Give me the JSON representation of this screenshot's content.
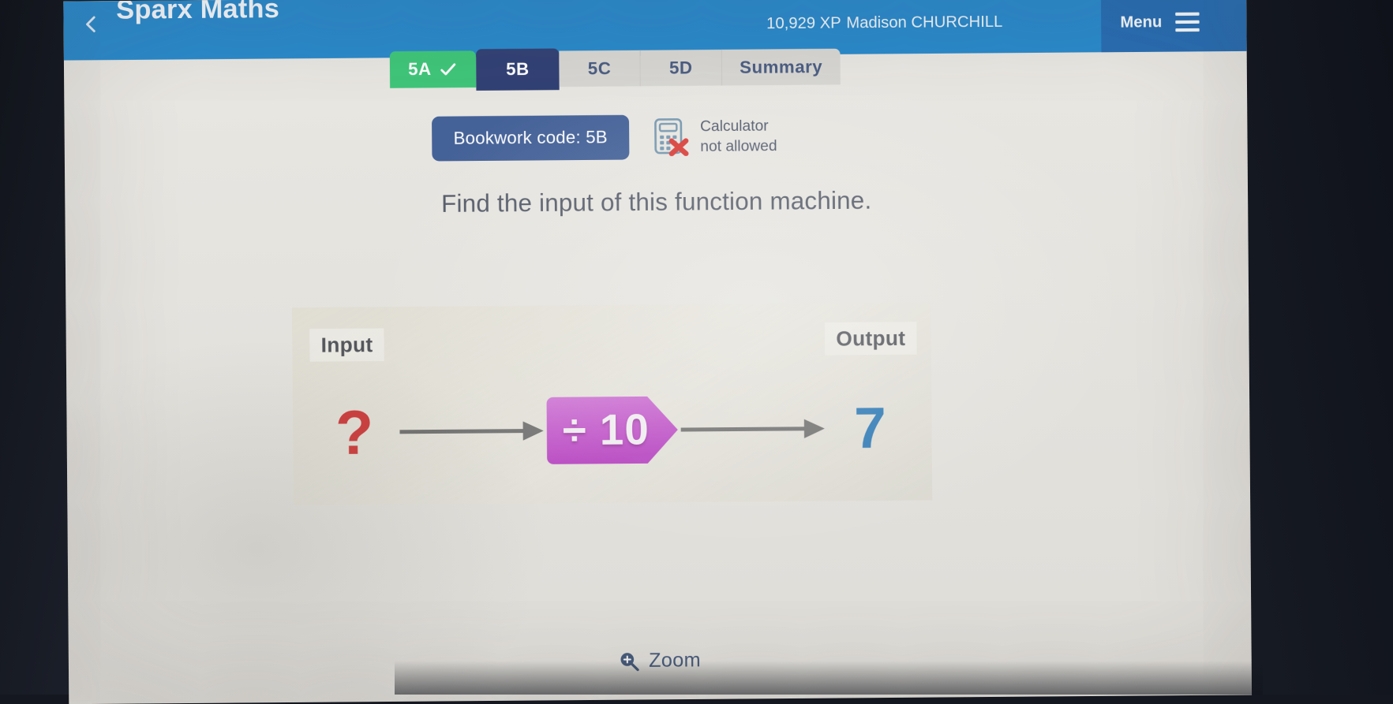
{
  "app": {
    "title": "Sparx Maths",
    "back_icon": "back-chevron-icon",
    "xp": "10,929 XP",
    "user": "Madison CHURCHILL",
    "menu_label": "Menu",
    "menu_icon": "hamburger-icon",
    "accent_blue": "#1f83c8",
    "accent_blue_dark": "#1c65ae"
  },
  "tabs": [
    {
      "label": "5A",
      "state": "completed",
      "icon": "check-icon",
      "color": "#35c473"
    },
    {
      "label": "5B",
      "state": "active",
      "color": "#27376e"
    },
    {
      "label": "5C",
      "state": "idle",
      "color": "#d6d5d1"
    },
    {
      "label": "5D",
      "state": "idle",
      "color": "#d6d5d1"
    },
    {
      "label": "Summary",
      "state": "idle",
      "color": "#d6d5d1"
    }
  ],
  "bookwork": {
    "code_label": "Bookwork code: 5B",
    "badge_color": "#3b5a94"
  },
  "calculator": {
    "icon": "calculator-not-allowed-icon",
    "line1": "Calculator",
    "line2": "not allowed"
  },
  "question": {
    "prompt": "Find the input of this function machine."
  },
  "machine": {
    "input_label": "Input",
    "output_label": "Output",
    "input_value": "?",
    "input_color": "#cf3434",
    "output_value": "7",
    "output_color": "#2878b8",
    "operation": "÷ 10",
    "operation_color": "#c657cf",
    "arrow_color": "#6e6e6e"
  },
  "footer": {
    "zoom_label": "Zoom",
    "zoom_icon": "magnifier-plus-icon"
  }
}
